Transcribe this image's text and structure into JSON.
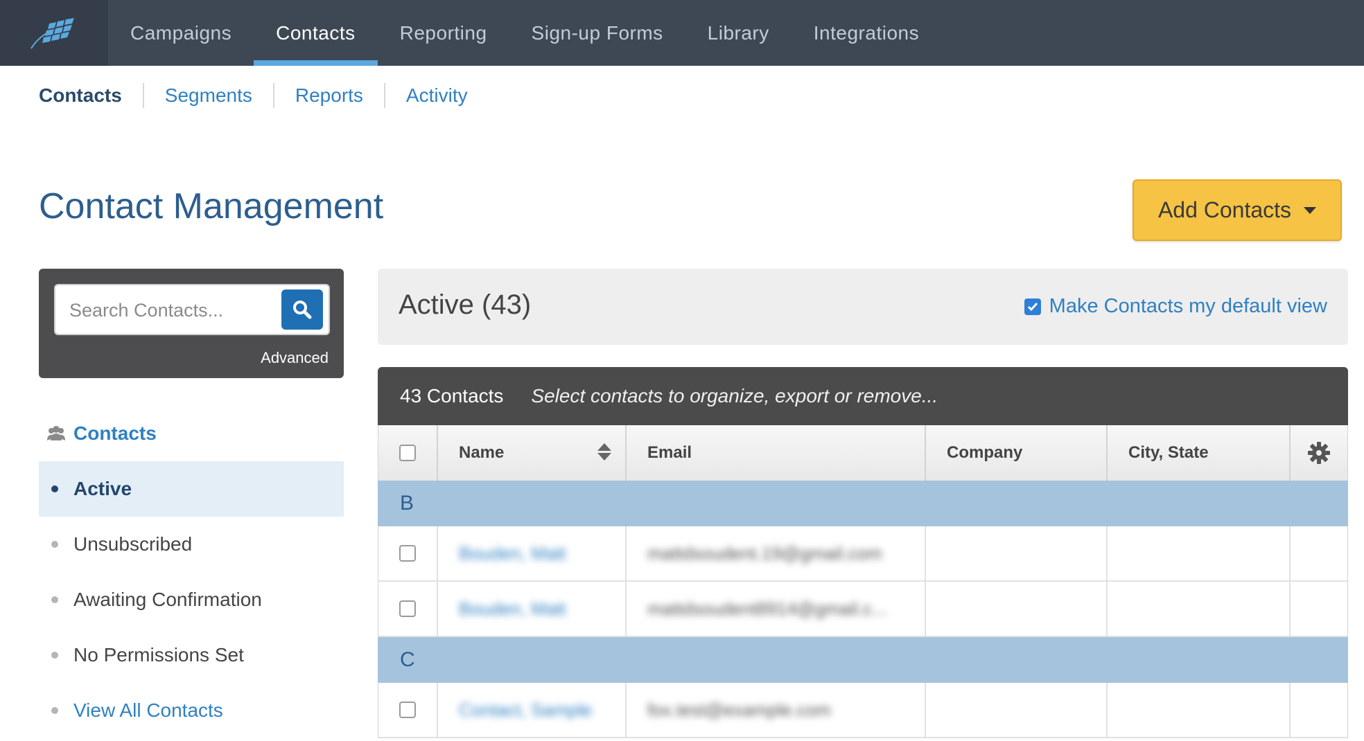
{
  "topnav": {
    "logo_icon": "brand-logo-icon",
    "items": [
      {
        "label": "Campaigns"
      },
      {
        "label": "Contacts",
        "active": true
      },
      {
        "label": "Reporting"
      },
      {
        "label": "Sign-up Forms"
      },
      {
        "label": "Library"
      },
      {
        "label": "Integrations"
      }
    ]
  },
  "subnav": {
    "items": [
      {
        "label": "Contacts"
      },
      {
        "label": "Segments"
      },
      {
        "label": "Reports"
      },
      {
        "label": "Activity"
      }
    ]
  },
  "page": {
    "title": "Contact Management",
    "add_button": "Add Contacts"
  },
  "search": {
    "placeholder": "Search Contacts...",
    "advanced_label": "Advanced"
  },
  "sidebar": {
    "header": "Contacts",
    "items": [
      {
        "label": "Active",
        "active": true
      },
      {
        "label": "Unsubscribed"
      },
      {
        "label": "Awaiting Confirmation"
      },
      {
        "label": "No Permissions Set"
      },
      {
        "label": "View All Contacts",
        "link": true
      }
    ]
  },
  "panel": {
    "title": "Active (43)",
    "default_view_label": "Make Contacts my default view",
    "default_view_checked": true
  },
  "table": {
    "count_label": "43 Contacts",
    "hint": "Select contacts to organize, export or remove...",
    "columns": {
      "name": "Name",
      "email": "Email",
      "company": "Company",
      "city_state": "City, State"
    },
    "groups": [
      {
        "letter": "B",
        "rows": [
          {
            "name": "Bouden, Matt",
            "email": "mattdsoudent.19@gmail.com",
            "company": "",
            "city": ""
          },
          {
            "name": "Bouden, Matt",
            "email": "mattdsoudent8914@gmail.c...",
            "company": "",
            "city": ""
          }
        ]
      },
      {
        "letter": "C",
        "rows": [
          {
            "name": "Contact, Sample",
            "email": "fox.test@example.com",
            "company": "",
            "city": ""
          }
        ]
      }
    ]
  },
  "colors": {
    "nav_bg": "#3e4855",
    "accent_blue": "#2f80c2",
    "title_blue": "#2d5e8e",
    "button_yellow": "#f6c344",
    "group_row": "#a5c3dc"
  }
}
